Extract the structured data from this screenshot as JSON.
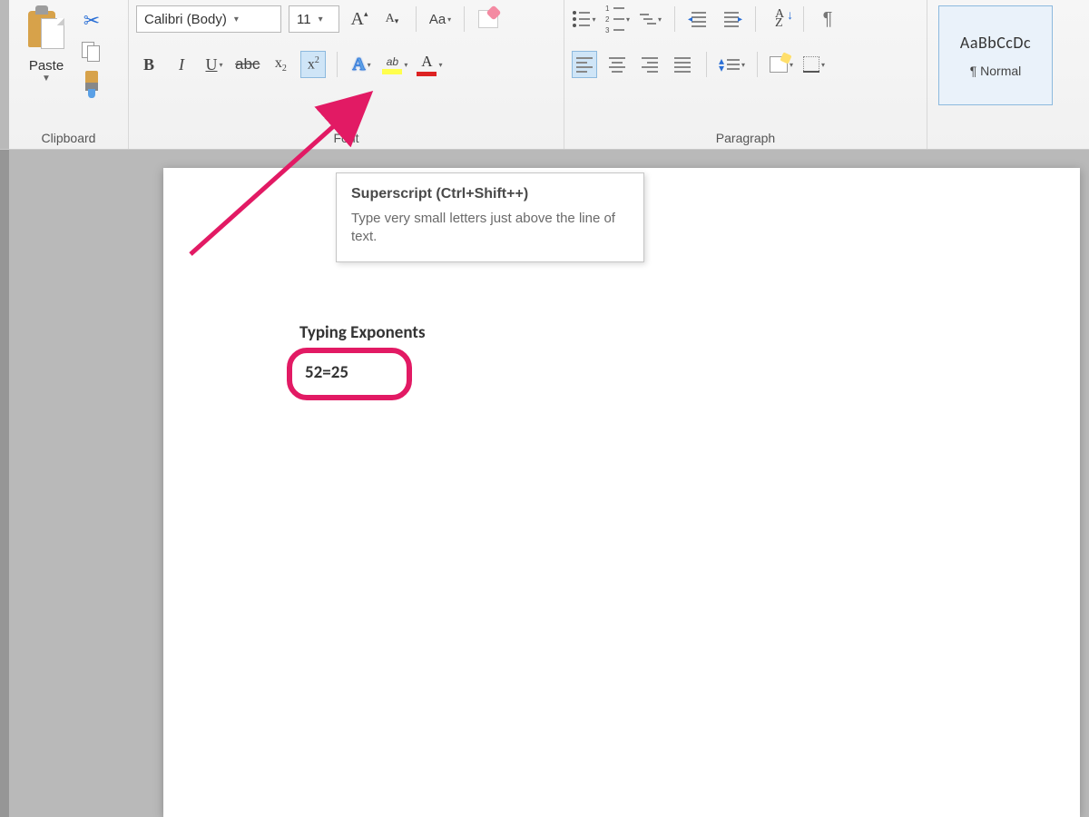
{
  "ribbon": {
    "clipboard": {
      "label": "Clipboard",
      "paste": "Paste"
    },
    "font": {
      "label": "Font",
      "font_name": "Calibri (Body)",
      "font_size": "11",
      "change_case": "Aa",
      "grow": "A",
      "shrink": "A",
      "bold": "B",
      "italic": "I",
      "underline": "U",
      "strike": "abc",
      "subscript": "x",
      "sub_small": "2",
      "superscript": "x",
      "sup_small": "2",
      "text_effect": "A",
      "highlight": "ab",
      "font_color": "A"
    },
    "paragraph": {
      "label": "Paragraph",
      "sort": "A\nZ",
      "pilcrow": "¶"
    },
    "styles": {
      "preview": "AaBbCcDc",
      "name": "¶ Normal"
    }
  },
  "tooltip": {
    "title": "Superscript (Ctrl+Shift++)",
    "body": "Type very small letters just above the line of text."
  },
  "document": {
    "heading": "Typing Exponents",
    "equation": "52=25"
  }
}
